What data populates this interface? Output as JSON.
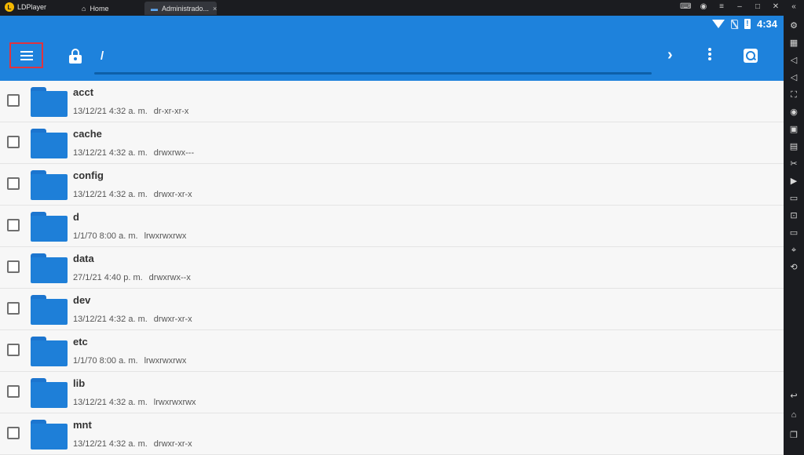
{
  "titlebar": {
    "app_name": "LDPlayer",
    "tabs": [
      {
        "label": "Home",
        "icon": "home-icon"
      },
      {
        "label": "Administrado...",
        "icon": "folder-icon",
        "close": "×"
      }
    ]
  },
  "statusbar": {
    "time": "4:34"
  },
  "appbar": {
    "path": "/",
    "chevron": "›"
  },
  "files": [
    {
      "name": "acct",
      "date": "13/12/21 4:32 a. m.",
      "perms": "dr-xr-xr-x"
    },
    {
      "name": "cache",
      "date": "13/12/21 4:32 a. m.",
      "perms": "drwxrwx---"
    },
    {
      "name": "config",
      "date": "13/12/21 4:32 a. m.",
      "perms": "drwxr-xr-x"
    },
    {
      "name": "d",
      "date": "1/1/70 8:00 a. m.",
      "perms": "lrwxrwxrwx"
    },
    {
      "name": "data",
      "date": "27/1/21 4:40 p. m.",
      "perms": "drwxrwx--x"
    },
    {
      "name": "dev",
      "date": "13/12/21 4:32 a. m.",
      "perms": "drwxr-xr-x"
    },
    {
      "name": "etc",
      "date": "1/1/70 8:00 a. m.",
      "perms": "lrwxrwxrwx"
    },
    {
      "name": "lib",
      "date": "13/12/21 4:32 a. m.",
      "perms": "lrwxrwxrwx"
    },
    {
      "name": "mnt",
      "date": "13/12/21 4:32 a. m.",
      "perms": "drwxr-xr-x"
    }
  ],
  "colors": {
    "primary": "#1e82dc",
    "highlight": "#e0333f",
    "folder": "#1e7fd8"
  }
}
